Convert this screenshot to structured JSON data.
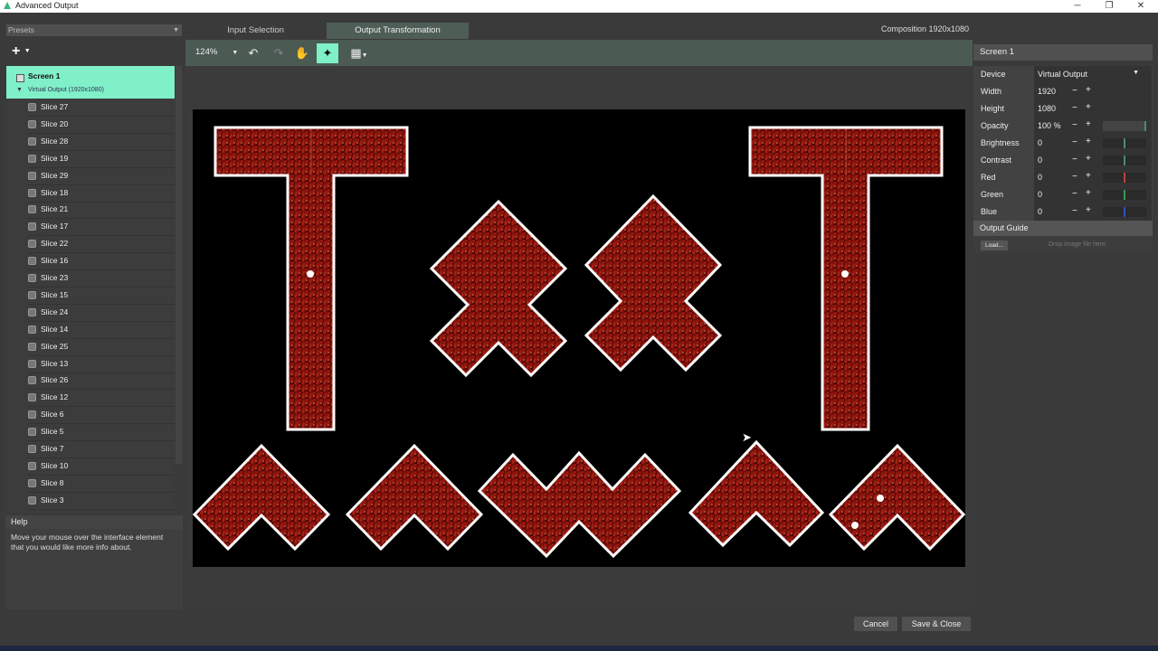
{
  "window": {
    "title": "Advanced Output"
  },
  "window_controls": {
    "minimize": "─",
    "restore": "❐",
    "close": "✕"
  },
  "left_panel": {
    "presets_label": "Presets",
    "add_label": "+",
    "screen": {
      "name": "Screen 1",
      "output": "Virtual Output (1920x1080)"
    },
    "slices": [
      "Slice 27",
      "Slice 20",
      "Slice 28",
      "Slice 19",
      "Slice 29",
      "Slice 18",
      "Slice 21",
      "Slice 17",
      "Slice 22",
      "Slice 16",
      "Slice 23",
      "Slice 15",
      "Slice 24",
      "Slice 14",
      "Slice 25",
      "Slice 13",
      "Slice 26",
      "Slice 12",
      "Slice 6",
      "Slice 5",
      "Slice 7",
      "Slice 10",
      "Slice 8",
      "Slice 3"
    ]
  },
  "help": {
    "title": "Help",
    "text": "Move your mouse over the interface element that you would like more info about."
  },
  "tabs": {
    "input_selection": "Input Selection",
    "output_transformation": "Output Transformation"
  },
  "composition_label": "Composition 1920x1080",
  "toolbar": {
    "zoom": "124%"
  },
  "right_panel": {
    "header": "Screen 1",
    "device_label": "Device",
    "device_value": "Virtual Output",
    "width_label": "Width",
    "width_value": "1920",
    "height_label": "Height",
    "height_value": "1080",
    "opacity_label": "Opacity",
    "opacity_value": "100 %",
    "brightness_label": "Brightness",
    "brightness_value": "0",
    "contrast_label": "Contrast",
    "contrast_value": "0",
    "red_label": "Red",
    "red_value": "0",
    "green_label": "Green",
    "green_value": "0",
    "blue_label": "Blue",
    "blue_value": "0",
    "guide_header": "Output Guide",
    "load_label": "Load...",
    "drop_text": "Drop image file here."
  },
  "footer": {
    "cancel": "Cancel",
    "save_close": "Save & Close"
  },
  "colors": {
    "accent": "#7ff0c8",
    "red_mark": "#c04040",
    "green_mark": "#3c9a50",
    "blue_mark": "#3050c0",
    "neutral_mark": "#4a8a7a"
  }
}
